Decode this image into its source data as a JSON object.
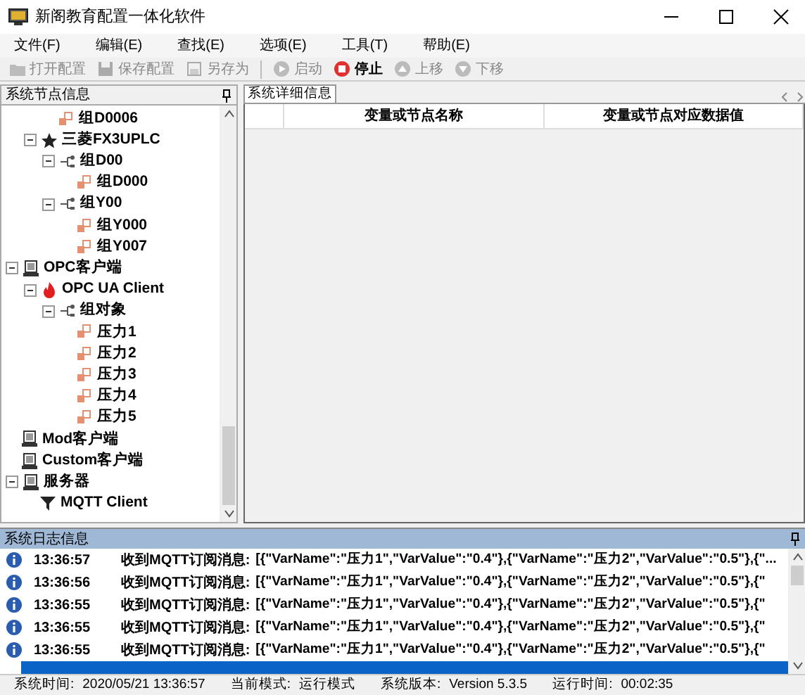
{
  "window": {
    "title": "新阁教育配置一体化软件"
  },
  "menu": [
    "文件(F)",
    "编辑(E)",
    "查找(E)",
    "选项(E)",
    "工具(T)",
    "帮助(E)"
  ],
  "toolbar": [
    {
      "label": "打开配置",
      "kind": "open",
      "disabled": true
    },
    {
      "label": "保存配置",
      "kind": "save",
      "disabled": true
    },
    {
      "label": "另存为",
      "kind": "saveas",
      "disabled": true
    },
    {
      "kind": "separator"
    },
    {
      "label": "启动",
      "kind": "start",
      "disabled": true
    },
    {
      "label": "停止",
      "kind": "stop",
      "disabled": false
    },
    {
      "label": "上移",
      "kind": "up",
      "disabled": true
    },
    {
      "label": "下移",
      "kind": "down",
      "disabled": true
    }
  ],
  "tree_panel": {
    "title": "系统节点信息",
    "partial_branch": [
      {
        "children": [
          {
            "label": "组D0006",
            "kind": "tag"
          }
        ]
      },
      {
        "label": "三菱FX3UPLC",
        "kind": "star",
        "expanded": true,
        "children": [
          {
            "label": "组D00",
            "kind": "group",
            "expanded": true,
            "children": [
              {
                "label": "组D000",
                "kind": "tag"
              }
            ]
          },
          {
            "label": "组Y00",
            "kind": "group",
            "expanded": true,
            "children": [
              {
                "label": "组Y000",
                "kind": "tag"
              },
              {
                "label": "组Y007",
                "kind": "tag"
              }
            ]
          }
        ]
      }
    ],
    "items": [
      {
        "label": "OPC客户端",
        "kind": "client",
        "expanded": true,
        "children": [
          {
            "label": "OPC UA Client",
            "kind": "fire",
            "expanded": true,
            "children": [
              {
                "label": "组对象",
                "kind": "group",
                "expanded": true,
                "children": [
                  {
                    "label": "压力1",
                    "kind": "tag"
                  },
                  {
                    "label": "压力2",
                    "kind": "tag"
                  },
                  {
                    "label": "压力3",
                    "kind": "tag"
                  },
                  {
                    "label": "压力4",
                    "kind": "tag"
                  },
                  {
                    "label": "压力5",
                    "kind": "tag"
                  }
                ]
              }
            ]
          }
        ]
      },
      {
        "label": "Mod客户端",
        "kind": "client"
      },
      {
        "label": "Custom客户端",
        "kind": "client"
      },
      {
        "label": "服务器",
        "kind": "client",
        "expanded": true,
        "children": [
          {
            "label": "MQTT Client",
            "kind": "funnel"
          }
        ]
      }
    ]
  },
  "detail_panel": {
    "tab": "系统详细信息",
    "columns": [
      "变量或节点名称",
      "变量或节点对应数据值"
    ]
  },
  "log_panel": {
    "title": "系统日志信息",
    "rows": [
      {
        "time": "13:36:57",
        "message": "收到MQTT订阅消息:",
        "content": "[{\"VarName\":\"压力1\",\"VarValue\":\"0.4\"},{\"VarName\":\"压力2\",\"VarValue\":\"0.5\"},{\"...",
        "selected": false
      },
      {
        "time": "13:36:56",
        "message": "收到MQTT订阅消息:",
        "content": "[{\"VarName\":\"压力1\",\"VarValue\":\"0.4\"},{\"VarName\":\"压力2\",\"VarValue\":\"0.5\"},{\"",
        "selected": false
      },
      {
        "time": "13:36:55",
        "message": "收到MQTT订阅消息:",
        "content": "[{\"VarName\":\"压力1\",\"VarValue\":\"0.4\"},{\"VarName\":\"压力2\",\"VarValue\":\"0.5\"},{\"",
        "selected": false
      },
      {
        "time": "13:36:55",
        "message": "收到MQTT订阅消息:",
        "content": "[{\"VarName\":\"压力1\",\"VarValue\":\"0.4\"},{\"VarName\":\"压力2\",\"VarValue\":\"0.5\"},{\"",
        "selected": false
      },
      {
        "time": "13:36:55",
        "message": "收到MQTT订阅消息:",
        "content": "[{\"VarName\":\"压力1\",\"VarValue\":\"0.4\"},{\"VarName\":\"压力2\",\"VarValue\":\"0.5\"},{\"",
        "selected": false
      },
      {
        "selected": true
      }
    ]
  },
  "status_bar": [
    {
      "label": "系统时间:",
      "value": "2020/05/21 13:36:57"
    },
    {
      "label": "当前模式:",
      "value": "运行模式"
    },
    {
      "label": "系统版本:",
      "value": "Version  5.3.5"
    },
    {
      "label": "运行时间:",
      "value": "00:02:35"
    }
  ]
}
